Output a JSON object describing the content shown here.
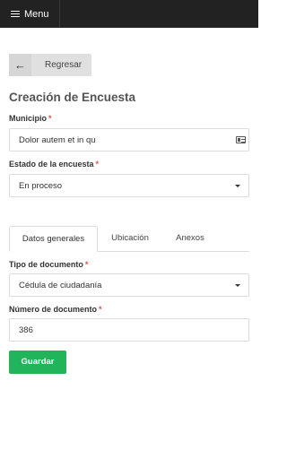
{
  "header": {
    "menu_label": "Menu"
  },
  "back_button": {
    "label": "Regresar"
  },
  "page_title": "Creación de Encuesta",
  "form": {
    "municipio": {
      "label": "Municipio",
      "required_mark": "*",
      "value": "Dolor autem et in qu"
    },
    "estado": {
      "label": "Estado de la encuesta",
      "required_mark": "*",
      "value": "En proceso"
    }
  },
  "tabs": [
    {
      "label": "Datos generales",
      "active": true
    },
    {
      "label": "Ubicación",
      "active": false
    },
    {
      "label": "Anexos",
      "active": false
    }
  ],
  "datos_generales": {
    "tipo_documento": {
      "label": "Tipo de documento",
      "required_mark": "*",
      "value": "Cédula de ciudadanía"
    },
    "numero_documento": {
      "label": "Número de documento",
      "required_mark": "*",
      "value": "386"
    }
  },
  "save_button": {
    "label": "Guardar"
  },
  "colors": {
    "topbar": "#222222",
    "save": "#22b45a",
    "required": "#d9534f"
  }
}
